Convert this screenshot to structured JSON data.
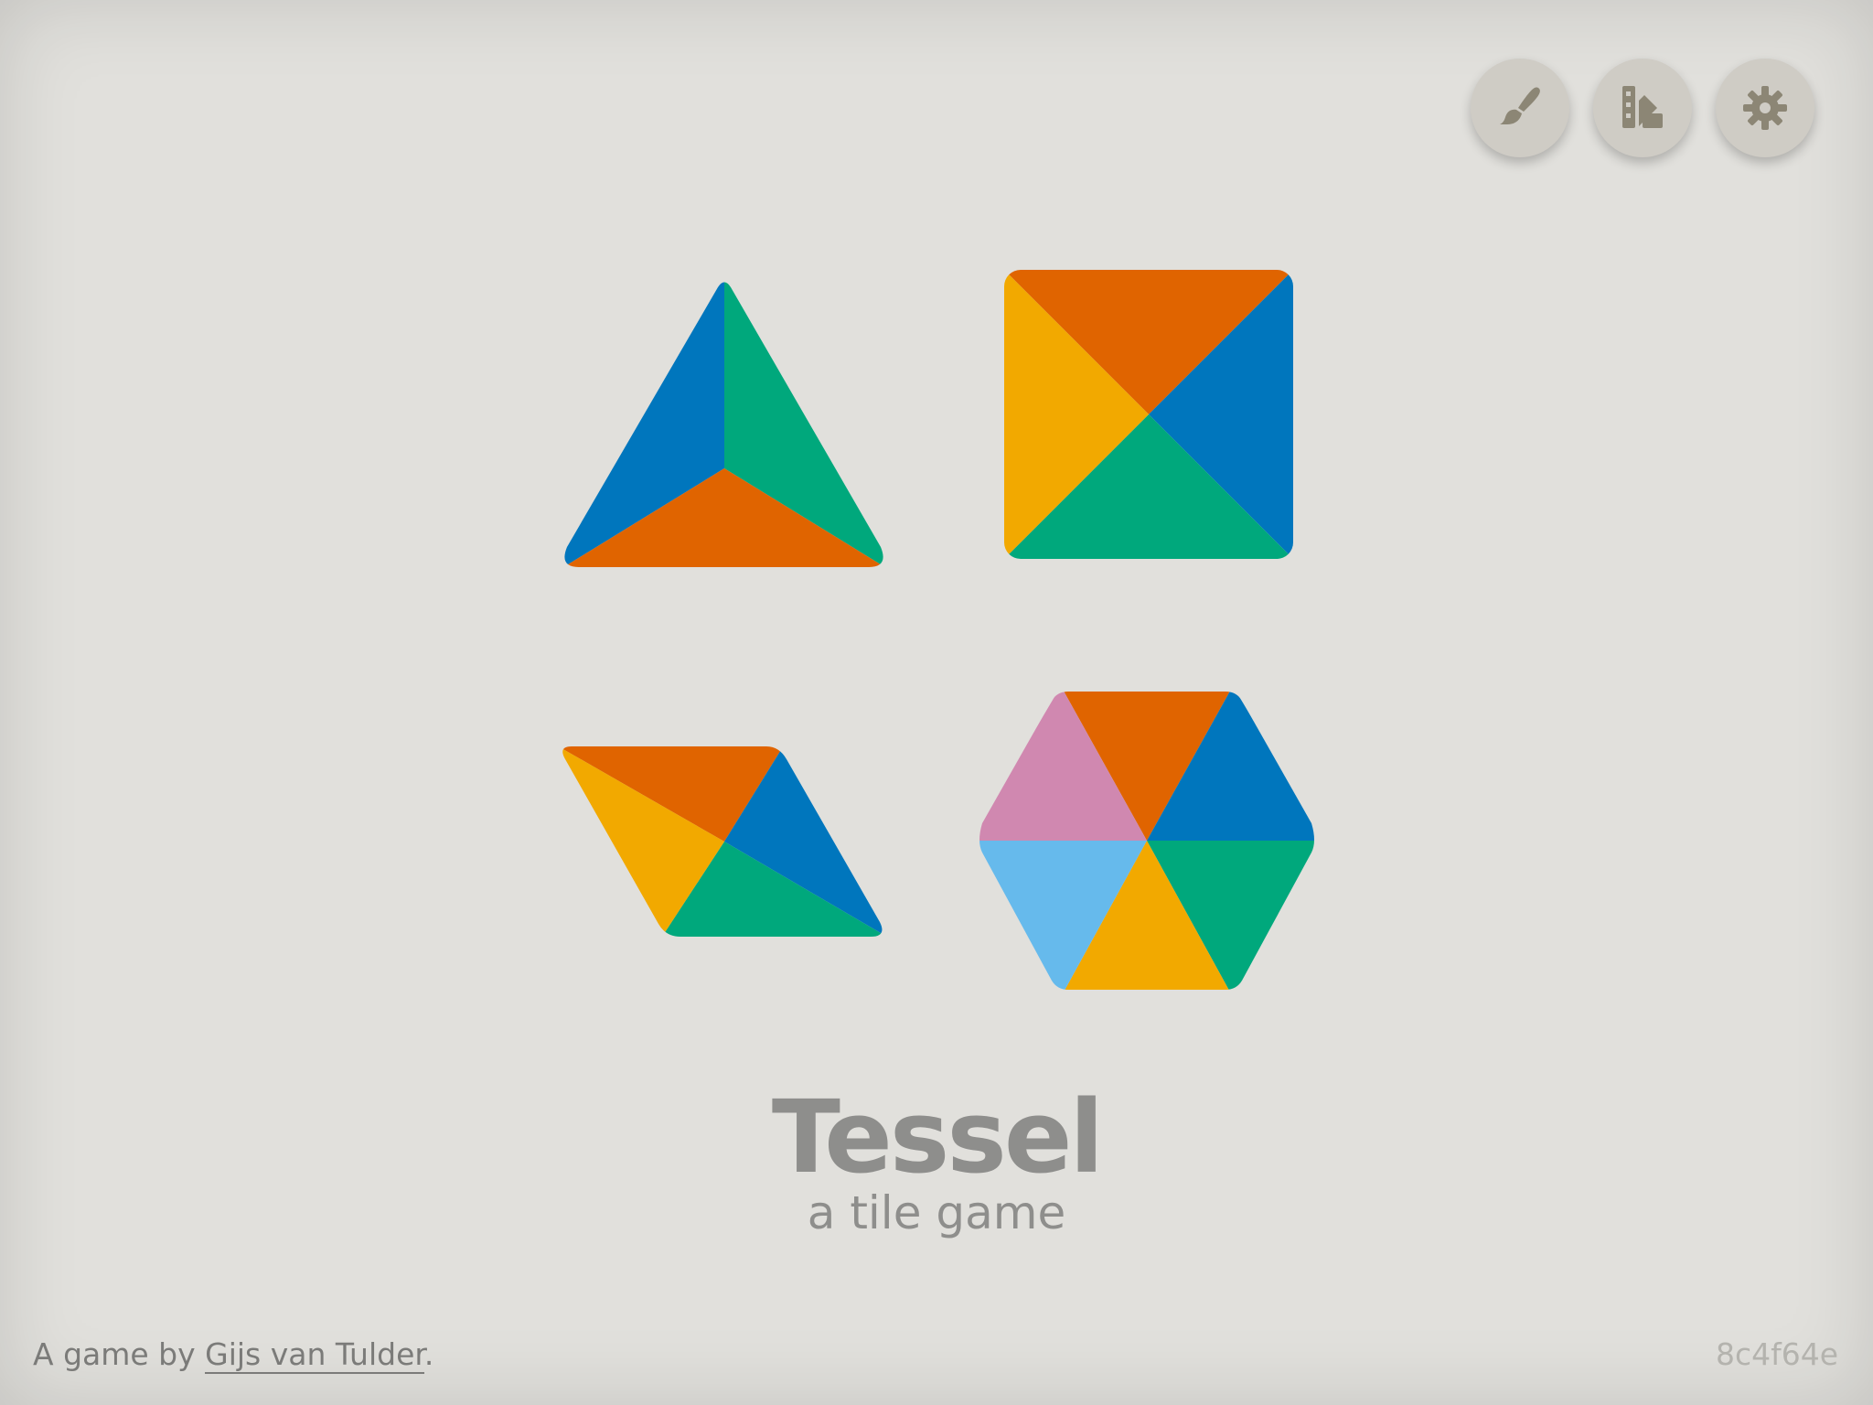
{
  "toolbar": {
    "buttons": [
      {
        "name": "paint-brush-button",
        "icon": "paint-brush-icon"
      },
      {
        "name": "palette-button",
        "icon": "color-swatch-icon"
      },
      {
        "name": "settings-button",
        "icon": "gear-icon"
      }
    ],
    "icon_color": "#8c8675",
    "button_color": "#cfccc5"
  },
  "tiles": [
    {
      "shape": "triangle",
      "colors": [
        "#0076bd",
        "#00a87c",
        "#e06400"
      ]
    },
    {
      "shape": "square",
      "colors": [
        "#e06400",
        "#0076bd",
        "#00a87c",
        "#f2a900"
      ]
    },
    {
      "shape": "rhombus",
      "colors": [
        "#e06400",
        "#0076bd",
        "#00a87c",
        "#f2a900"
      ]
    },
    {
      "shape": "hexagon",
      "colors": [
        "#e06400",
        "#0076bd",
        "#00a87c",
        "#f2a900",
        "#66baec",
        "#d088b0"
      ]
    }
  ],
  "title": "Tessel",
  "subtitle": "a tile game",
  "footer": {
    "prefix": "A game by ",
    "author": "Gijs van Tulder",
    "suffix": "."
  },
  "version": "8c4f64e",
  "colors": {
    "background": "#e1e0dc",
    "text": "#8e8e8c"
  }
}
